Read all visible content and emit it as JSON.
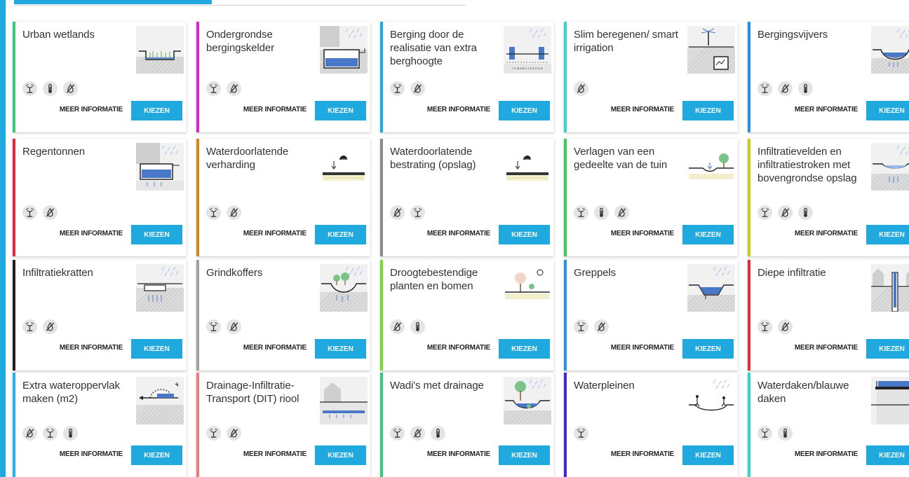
{
  "tabs": {
    "active_color": "#1fa9de"
  },
  "meer_label": "MEER INFORMATIE",
  "kiezen_label": "KIEZEN",
  "rows": [
    {
      "cards": [
        {
          "title": "Urban wetlands",
          "accent": "#3cc97b",
          "illustration": "wetland",
          "icons": [
            "sprinkler-icon",
            "thermometer-icon",
            "no-drought-icon"
          ]
        },
        {
          "title": "Ondergrondse bergingskelder",
          "accent": "#d529c8",
          "illustration": "cellar",
          "icons": [
            "sprinkler-icon",
            "no-drought-icon"
          ]
        },
        {
          "title": "Berging door de realisatie van extra berghoogte",
          "accent": "#1fa9de",
          "illustration": "berghoogte",
          "icons": [
            "sprinkler-icon",
            "no-drought-icon"
          ]
        },
        {
          "title": "Slim beregenen/ smart irrigation",
          "accent": "#3bd3c9",
          "illustration": "smart-irrigation",
          "icons": [
            "no-drought-icon"
          ]
        },
        {
          "title": "Bergingsvijvers",
          "accent": "#2c8fe0",
          "illustration": "pond",
          "icons": [
            "sprinkler-icon",
            "no-drought-icon",
            "thermometer-icon"
          ]
        }
      ]
    },
    {
      "cards": [
        {
          "title": "Regentonnen",
          "accent": "#e02d3c",
          "illustration": "rain-barrel",
          "icons": [
            "sprinkler-icon",
            "no-drought-icon"
          ]
        },
        {
          "title": "Waterdoorlatende verharding",
          "accent": "#d08a19",
          "illustration": "permeable",
          "icons": [
            "sprinkler-icon",
            "no-drought-icon"
          ]
        },
        {
          "title": "Waterdoorlatende bestrating (opslag)",
          "accent": "#8c8c8c",
          "illustration": "permeable",
          "icons": [
            "no-drought-icon",
            "sprinkler-icon"
          ]
        },
        {
          "title": "Verlagen van een gedeelte van de tuin",
          "accent": "#3cc960",
          "illustration": "lower-garden",
          "icons": [
            "sprinkler-icon",
            "thermometer-icon",
            "no-drought-icon"
          ]
        },
        {
          "title": "Infiltratievelden en infiltratiestroken met bovengrondse opslag",
          "accent": "#c9cb1c",
          "illustration": "infiltration-field",
          "icons": [
            "sprinkler-icon",
            "no-drought-icon",
            "thermometer-icon"
          ]
        }
      ]
    },
    {
      "cards": [
        {
          "title": "Infiltratiekratten",
          "accent": "#2a1a22",
          "illustration": "crates",
          "icons": [
            "sprinkler-icon",
            "no-drought-icon"
          ]
        },
        {
          "title": "Grindkoffers",
          "accent": "#a0a0a0",
          "illustration": "gravel",
          "icons": [
            "sprinkler-icon",
            "no-drought-icon"
          ]
        },
        {
          "title": "Droogtebestendige planten en bomen",
          "accent": "#7bd63c",
          "illustration": "drought-plants",
          "icons": [
            "no-drought-icon",
            "thermometer-icon"
          ]
        },
        {
          "title": "Greppels",
          "accent": "#2c8fe0",
          "illustration": "ditch",
          "icons": [
            "sprinkler-icon",
            "no-drought-icon"
          ]
        },
        {
          "title": "Diepe infiltratie",
          "accent": "#e02d3c",
          "illustration": "deep-infiltration",
          "icons": [
            "sprinkler-icon",
            "no-drought-icon"
          ]
        }
      ]
    },
    {
      "cards": [
        {
          "title": "Extra wateroppervlak maken (m2)",
          "accent": "#2ab0e8",
          "illustration": "water-surface",
          "icons": [
            "no-drought-icon",
            "sprinkler-icon",
            "thermometer-icon"
          ]
        },
        {
          "title": "Drainage-Infiltratie-Transport (DIT) riool",
          "accent": "#e87a80",
          "illustration": "dit-sewer",
          "icons": [
            "sprinkler-icon",
            "no-drought-icon"
          ]
        },
        {
          "title": "Wadi's met drainage",
          "accent": "#3cc97b",
          "illustration": "wadi",
          "icons": [
            "sprinkler-icon",
            "no-drought-icon",
            "thermometer-icon"
          ]
        },
        {
          "title": "Waterpleinen",
          "accent": "#3a2bd6",
          "illustration": "water-square",
          "icons": [
            "sprinkler-icon"
          ]
        },
        {
          "title": "Waterdaken/blauwe daken",
          "accent": "#3bd3c9",
          "illustration": "blue-roof",
          "icons": [
            "sprinkler-icon",
            "thermometer-icon"
          ]
        }
      ]
    }
  ]
}
